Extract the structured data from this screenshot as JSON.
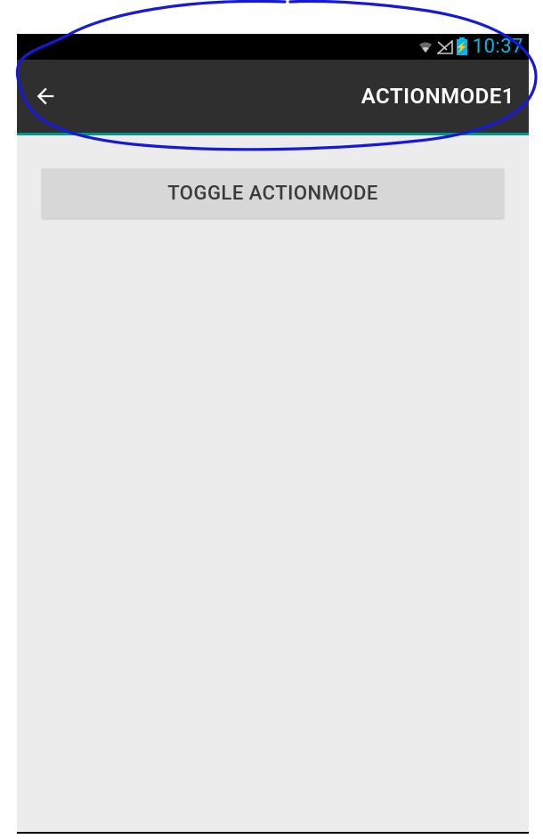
{
  "status_bar": {
    "time": "10:37"
  },
  "action_bar": {
    "title": "ACTIONMODE1"
  },
  "main": {
    "toggle_label": "TOGGLE ACTIONMODE"
  }
}
